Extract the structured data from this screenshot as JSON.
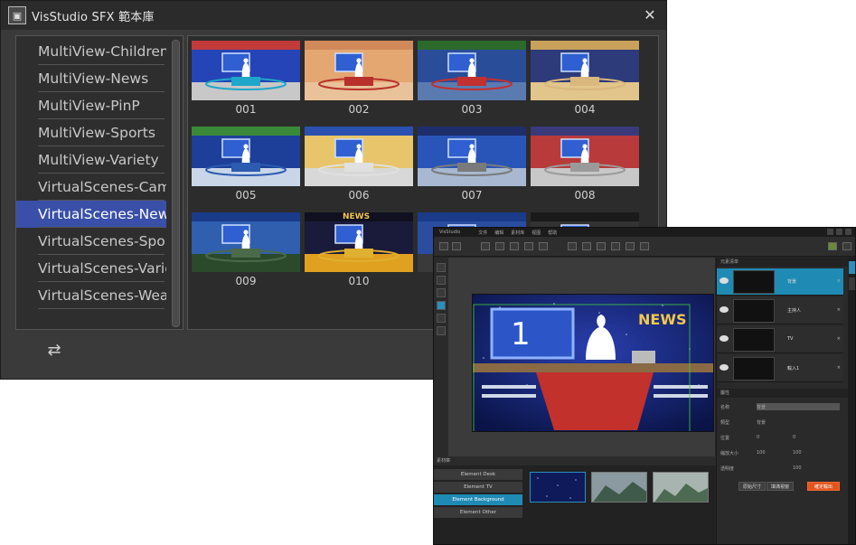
{
  "main_window": {
    "title": "VisStudio SFX 範本庫",
    "close_glyph": "✕",
    "logo_glyph": "▣",
    "refresh_glyph": "⇄"
  },
  "categories": [
    {
      "label": "MultiView-Children",
      "selected": false
    },
    {
      "label": "MultiView-News",
      "selected": false
    },
    {
      "label": "MultiView-PinP",
      "selected": false
    },
    {
      "label": "MultiView-Sports",
      "selected": false
    },
    {
      "label": "MultiView-Variety",
      "selected": false
    },
    {
      "label": "VirtualScenes-Cam",
      "selected": false
    },
    {
      "label": "VirtualScenes-New",
      "selected": true
    },
    {
      "label": "VirtualScenes-Spor",
      "selected": false
    },
    {
      "label": "VirtualScenes-Varie",
      "selected": false
    },
    {
      "label": "VirtualScenes-Wea",
      "selected": false
    }
  ],
  "thumbnails": [
    {
      "label": "001",
      "top": "#c23a3a",
      "wall": "#2444b8",
      "floor": "#c8c8c8",
      "desk": "#1fa6c9"
    },
    {
      "label": "002",
      "top": "#d08a5a",
      "wall": "#e4a772",
      "floor": "#e9c299",
      "desk": "#b8312b"
    },
    {
      "label": "003",
      "top": "#2b6a2b",
      "wall": "#2a4d9a",
      "floor": "#5a7bb0",
      "desk": "#c23030"
    },
    {
      "label": "004",
      "top": "#c9a15b",
      "wall": "#2d3b7a",
      "floor": "#e2c58a",
      "desk": "#d9b77d"
    },
    {
      "label": "005",
      "top": "#3a8a3a",
      "wall": "#1d3f9a",
      "floor": "#c9d6e8",
      "desk": "#2c5bb0"
    },
    {
      "label": "006",
      "top": "#2a50b0",
      "wall": "#e8c56a",
      "floor": "#d8d8d8",
      "desk": "#e0e0e0"
    },
    {
      "label": "007",
      "top": "#1d2e6a",
      "wall": "#2a55b8",
      "floor": "#a8b8d0",
      "desk": "#7a7a7a"
    },
    {
      "label": "008",
      "top": "#3a3a7a",
      "wall": "#b83a3a",
      "floor": "#c8c8c8",
      "desk": "#9a9a9a"
    },
    {
      "label": "009",
      "top": "#1a3a8a",
      "wall": "#2f5fae",
      "floor": "#2b4a2b",
      "desk": "#4a6a4a"
    },
    {
      "label": "010",
      "top": "#101020",
      "wall": "#1a1a3a",
      "floor": "#e0a020",
      "desk": "#e0b030",
      "banner": "NEWS"
    },
    {
      "label": "",
      "top": "#1a3a8a",
      "wall": "#2a4da0",
      "floor": "#3a3a3a",
      "desk": "#3a3a3a"
    },
    {
      "label": "",
      "top": "#1a1a1a",
      "wall": "#333333",
      "floor": "#444444",
      "desk": "#555555"
    }
  ],
  "editor": {
    "title": "VisStudio",
    "menu": [
      "文件",
      "编辑",
      "素材库",
      "视图",
      "帮助"
    ],
    "preview_banner": "NEWS",
    "preview_number": "1",
    "layers_header": "元素清单",
    "layers": [
      {
        "name": "背景",
        "selected": true
      },
      {
        "name": "主持人",
        "selected": false
      },
      {
        "name": "TV",
        "selected": false
      },
      {
        "name": "輸入1",
        "selected": false
      }
    ],
    "props_header": "屬性",
    "props": [
      {
        "label": "名称",
        "v1": "背景",
        "v2": ""
      },
      {
        "label": "類型",
        "v1": "背景",
        "v2": ""
      },
      {
        "label": "位置",
        "v1": "0",
        "v2": "0"
      },
      {
        "label": "縮放大小",
        "v1": "100",
        "v2": "100"
      },
      {
        "label": "透明度",
        "v1": "",
        "v2": "100"
      }
    ],
    "prop_buttons": [
      "原始尺寸",
      "填滿視窗",
      "確定輸出"
    ],
    "elements_header": "素材庫",
    "elements": [
      {
        "label": "Element Desk",
        "selected": false
      },
      {
        "label": "Element TV",
        "selected": false
      },
      {
        "label": "Element Background",
        "selected": true
      },
      {
        "label": "Element Other",
        "selected": false
      }
    ]
  }
}
